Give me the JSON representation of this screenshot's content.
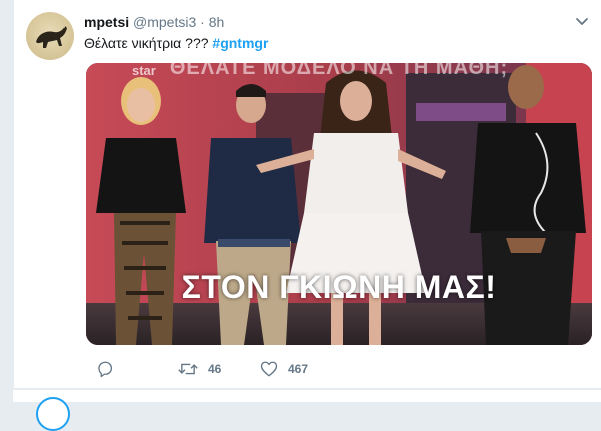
{
  "tweet": {
    "display_name": "mpetsi",
    "handle": "@mpetsi3",
    "separator": "·",
    "time": "8h",
    "text": "Θέλατε νικήτρια ???",
    "hashtag": "#gntmgr"
  },
  "media": {
    "watermark": "star",
    "top_caption": "ΘΕΛΑΤΕ ΜΟΔΕΛΟ ΝΑ ΤΗ ΜΑΘΗ;",
    "caption": "ΣΤΟΝ ΓΚΙΩΝΗ ΜΑΣ!"
  },
  "actions": {
    "reply_icon": "reply-icon",
    "retweet_icon": "retweet-icon",
    "retweet_count": "46",
    "like_icon": "heart-icon",
    "like_count": "467"
  },
  "colors": {
    "accent": "#1da1f2",
    "text": "#14171a",
    "muted": "#657786",
    "background": "#e6ecf0"
  }
}
